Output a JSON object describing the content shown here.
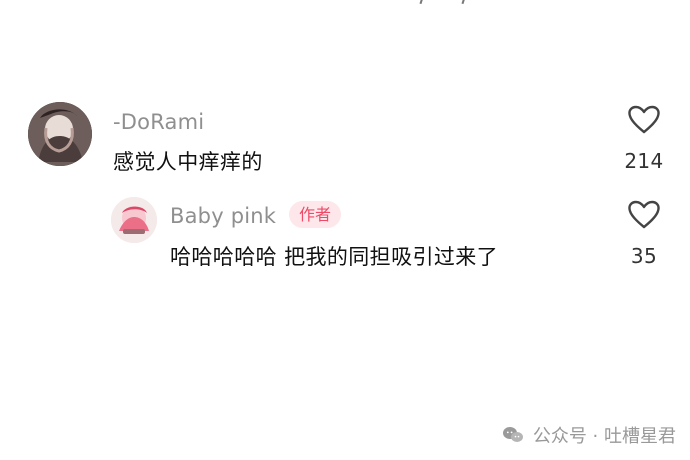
{
  "comments": [
    {
      "username": "-DoRami",
      "text": "感觉人中痒痒的",
      "likes": "214"
    },
    {
      "username": "Baby pink",
      "badge": "作者",
      "text": "哈哈哈哈哈 把我的同担吸引过来了",
      "likes": "35"
    }
  ],
  "watermark": {
    "text": "公众号 · 吐槽星君"
  },
  "icons": {
    "like": "heart-icon",
    "watermark": "wechat-icon"
  }
}
